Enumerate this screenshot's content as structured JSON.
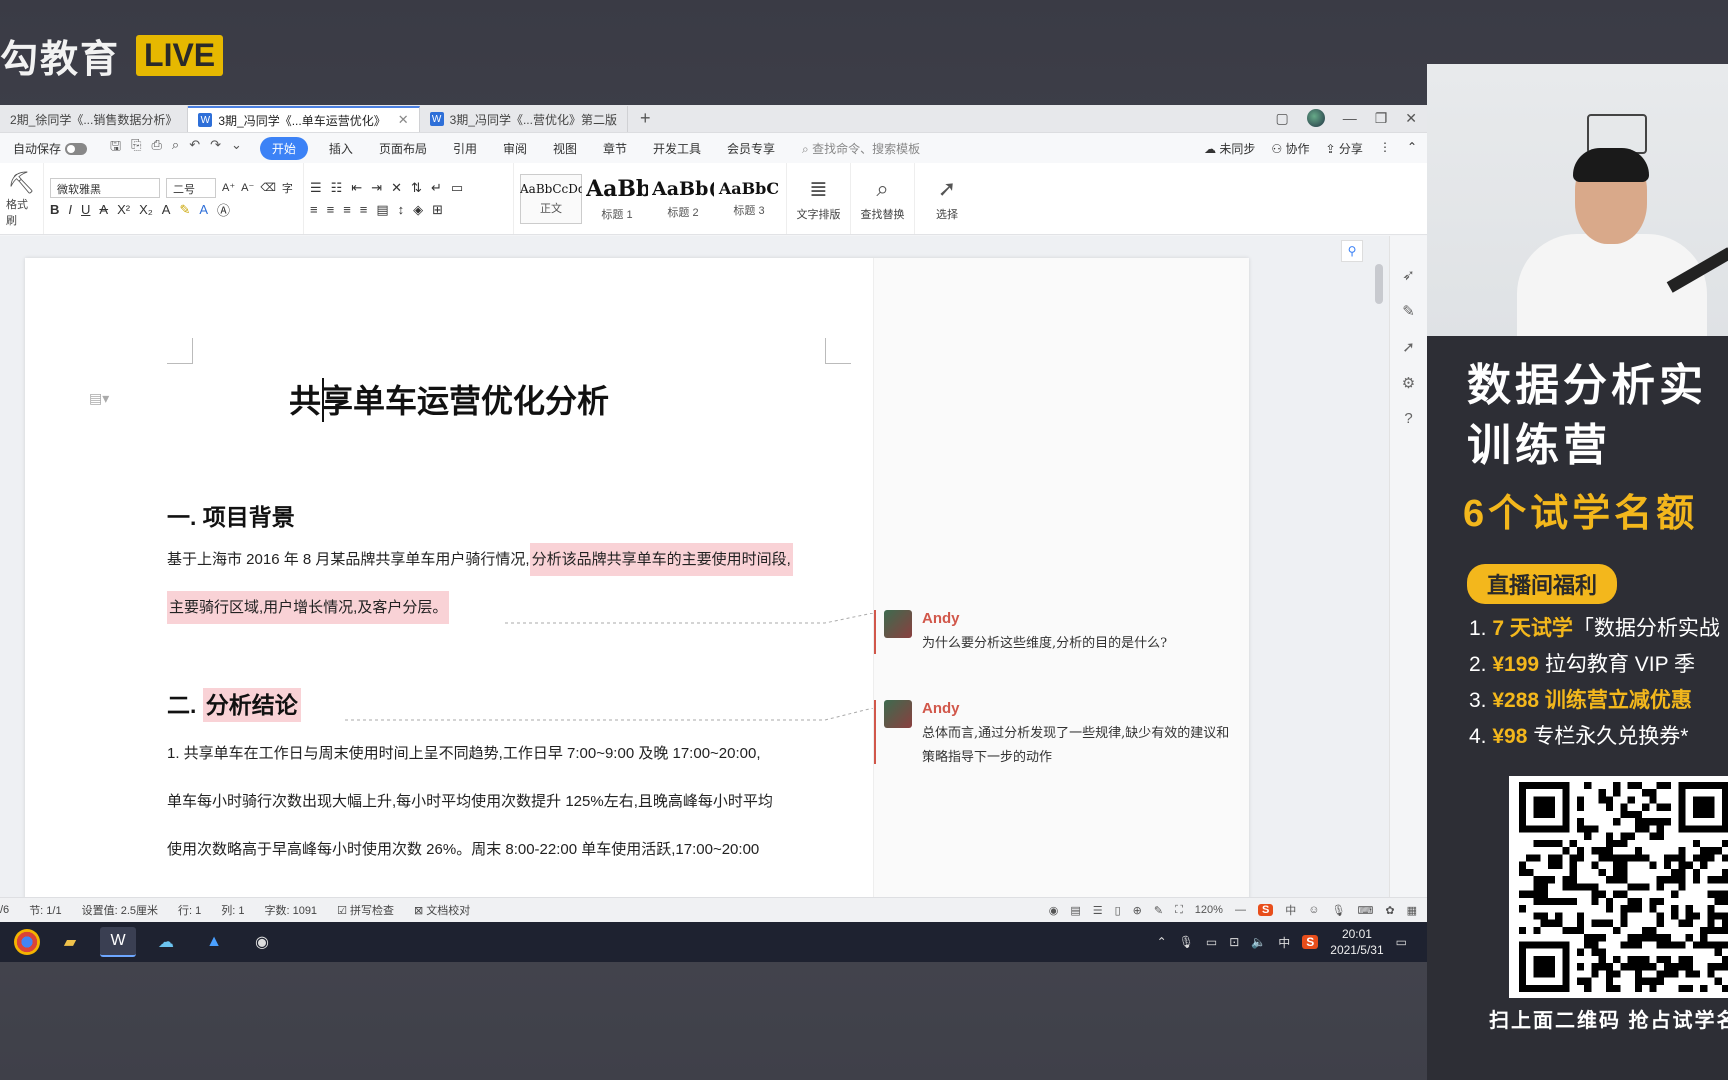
{
  "stream": {
    "brand": "勾教育",
    "live": "LIVE"
  },
  "tabs": [
    {
      "label": "2期_徐同学《...销售数据分析》",
      "active": false
    },
    {
      "label": "3期_冯同学《...单车运营优化》",
      "active": true
    },
    {
      "label": "3期_冯同学《...营优化》第二版",
      "active": false
    }
  ],
  "menu": {
    "autosave": "自动保存",
    "items": [
      "开始",
      "插入",
      "页面布局",
      "引用",
      "审阅",
      "视图",
      "章节",
      "开发工具",
      "会员专享"
    ],
    "search_placeholder": "查找命令、搜索模板",
    "right": [
      "未同步",
      "协作",
      "分享"
    ]
  },
  "ribbon": {
    "paint_format": "格式刷",
    "font_name": "微软雅黑",
    "font_size": "二号",
    "styles": [
      {
        "preview": "AaBbCcDd",
        "label": "正文"
      },
      {
        "preview": "AaBb",
        "label": "标题 1"
      },
      {
        "preview": "AaBb(",
        "label": "标题 2"
      },
      {
        "preview": "AaBbC",
        "label": "标题 3"
      }
    ],
    "text_layout": "文字排版",
    "find_replace": "查找替换",
    "select": "选择"
  },
  "document": {
    "title": "共享单车运营优化分析",
    "section1_heading": "一. 项目背景",
    "section1_p1_plain": "基于上海市 2016 年 8 月某品牌共享单车用户骑行情况,",
    "section1_p1_hl": "分析该品牌共享单车的主要使用时间段,",
    "section1_p2_hl": "主要骑行区域,用户增长情况,及客户分层。",
    "section2_prefix": "二.",
    "section2_heading": "分析结论",
    "section2_p1": "1.  共享单车在工作日与周末使用时间上呈不同趋势,工作日早 7:00~9:00 及晚 17:00~20:00,",
    "section2_p2": "单车每小时骑行次数出现大幅上升,每小时平均使用次数提升 125%左右,且晚高峰每小时平均",
    "section2_p3": "使用次数略高于早高峰每小时使用次数 26%。周末 8:00-22:00 单车使用活跃,17:00~20:00"
  },
  "comments": [
    {
      "author": "Andy",
      "text": "为什么要分析这些维度,分析的目的是什么?"
    },
    {
      "author": "Andy",
      "text": "总体而言,通过分析发现了一些规律,缺少有效的建议和策略指导下一步的动作"
    }
  ],
  "status": {
    "page": "/6",
    "section": "节: 1/1",
    "setting": "设置值: 2.5厘米",
    "row": "行: 1",
    "col": "列: 1",
    "words": "字数: 1091",
    "spell": "拼写检查",
    "proof": "文档校对",
    "zoom": "120%",
    "ime": "S",
    "ime_lang": "中"
  },
  "taskbar": {
    "time": "20:01",
    "date": "2021/5/31",
    "lang": "中"
  },
  "promo": {
    "title_line1": "数据分析实",
    "title_line2": "训练营",
    "subtitle": "6个试学名额",
    "badge": "直播间福利",
    "perks": [
      {
        "num": "1.",
        "hl": "7 天试学",
        "rest": "「数据分析实战"
      },
      {
        "num": "2.",
        "hl": "¥199",
        "rest": " 拉勾教育 VIP 季"
      },
      {
        "num": "3.",
        "hl": "¥288 训练营立减优惠",
        "rest": ""
      },
      {
        "num": "4.",
        "hl": "¥98",
        "rest": " 专栏永久兑换券*"
      }
    ],
    "qr_caption": "扫上面二维码  抢占试学名"
  },
  "colors": {
    "accent": "#3c82f6",
    "highlight": "#f9d2d6",
    "comment_name": "#d1574a",
    "promo_gold": "#f3b71c",
    "live_badge": "#e6b800"
  }
}
